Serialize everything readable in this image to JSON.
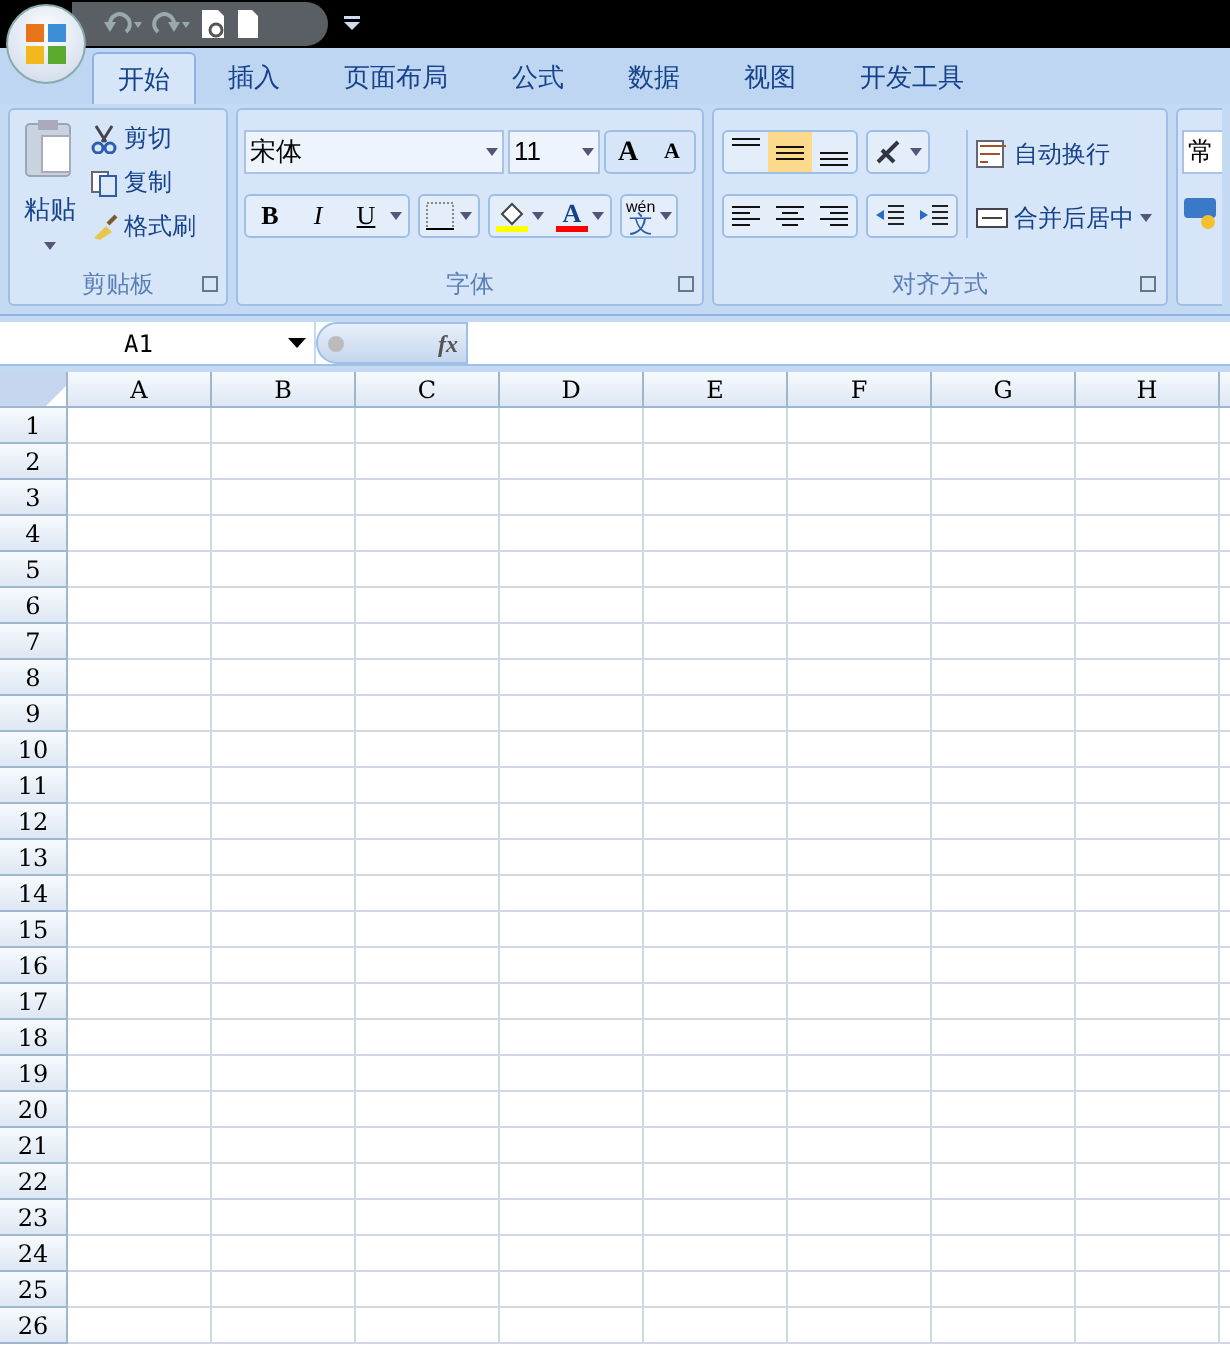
{
  "tabs": [
    {
      "label": "开始",
      "selected": true
    },
    {
      "label": "插入",
      "selected": false
    },
    {
      "label": "页面布局",
      "selected": false
    },
    {
      "label": "公式",
      "selected": false
    },
    {
      "label": "数据",
      "selected": false
    },
    {
      "label": "视图",
      "selected": false
    },
    {
      "label": "开发工具",
      "selected": false
    }
  ],
  "clipboard": {
    "paste": "粘贴",
    "items": [
      "剪切",
      "复制",
      "格式刷"
    ],
    "label": "剪贴板"
  },
  "font": {
    "name": "宋体",
    "size": "11",
    "grow": "A",
    "shrink": "A",
    "styles": [
      "B",
      "I",
      "U"
    ],
    "font_color_label": "A",
    "phonetic_top": "wén",
    "phonetic": "文",
    "label": "字体"
  },
  "alignment": {
    "vertical": [
      {
        "kind": "top",
        "selected": false
      },
      {
        "kind": "middle",
        "selected": true
      },
      {
        "kind": "bottom",
        "selected": false
      }
    ],
    "horizontal": [
      {
        "kind": "left",
        "selected": false
      },
      {
        "kind": "center",
        "selected": false
      },
      {
        "kind": "right",
        "selected": false
      }
    ],
    "wrap": "自动换行",
    "merge": "合并后居中",
    "label": "对齐方式"
  },
  "number": {
    "format": "常"
  },
  "formula_bar": {
    "name_box": "A1",
    "fx": "fx"
  },
  "columns": [
    "A",
    "B",
    "C",
    "D",
    "E",
    "F",
    "G",
    "H"
  ],
  "rows": [
    "1",
    "2",
    "3",
    "4",
    "5",
    "6",
    "7",
    "8",
    "9",
    "10",
    "11",
    "12",
    "13",
    "14",
    "15",
    "16",
    "17",
    "18",
    "19",
    "20",
    "21",
    "22",
    "23",
    "24",
    "25",
    "26"
  ]
}
